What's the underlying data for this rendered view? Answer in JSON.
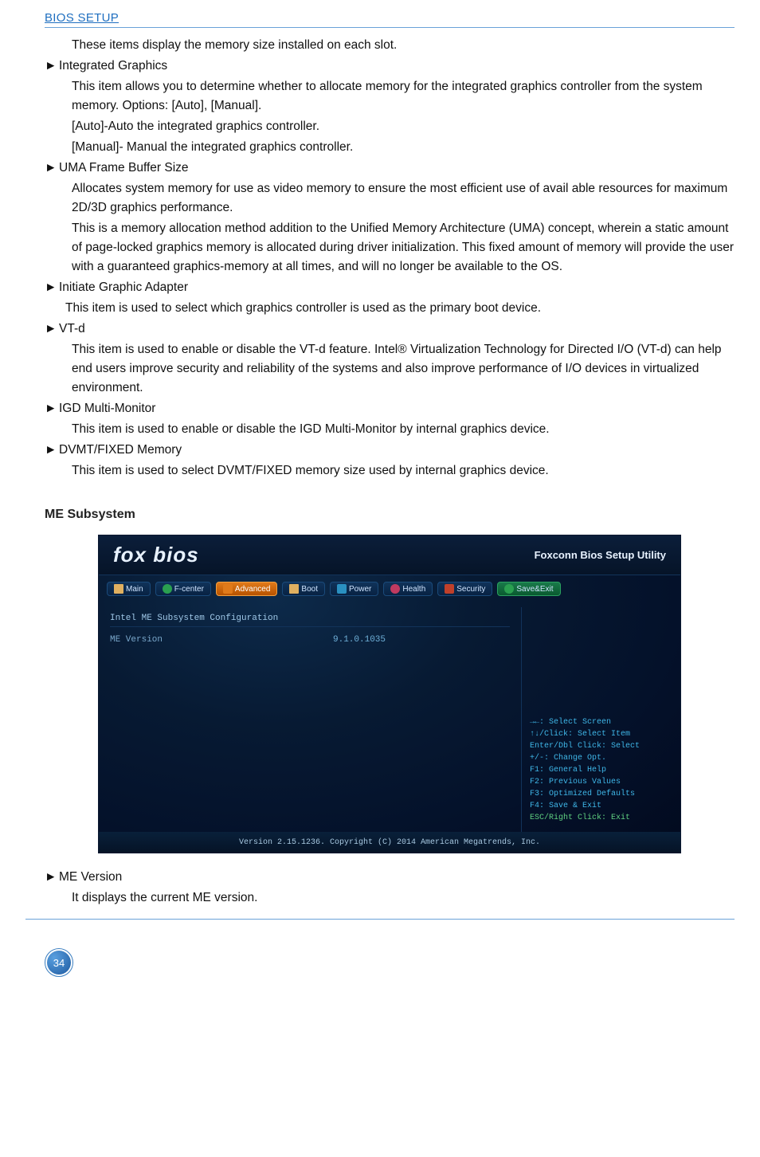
{
  "header": {
    "title": "BIOS SETUP"
  },
  "body": {
    "slots_note": "These items display the memory size installed on each slot.",
    "integrated_graphics": {
      "title": "Integrated Graphics",
      "p1": "This item allows you to determine whether to allocate memory for the integrated graphics controller from the system memory. Options: [Auto], [Manual].",
      "p2": "[Auto]-Auto the integrated graphics controller.",
      "p3": "[Manual]- Manual the integrated graphics controller."
    },
    "uma": {
      "title": "UMA Frame Buffer Size",
      "p1": "Allocates system memory for use as video memory to ensure the most efficient use of avail able resources for maximum 2D/3D graphics performance.",
      "p2": "This is a memory allocation method addition to the Unified Memory Architecture (UMA) concept, wherein a static amount of page-locked graphics memory is allocated during driver initialization. This fixed amount of memory will provide the user with a guaranteed graphics-memory at all times, and will no longer be available to the OS."
    },
    "initiate": {
      "title": "Initiate Graphic Adapter",
      "p1": "This item is used to select which graphics controller is used as the primary boot device."
    },
    "vtd": {
      "title": "VT-d",
      "p1": "This item is used to enable or disable the VT-d feature. Intel® Virtualization Technology for Directed I/O (VT-d) can help end users improve security and reliability of the systems and also improve performance of I/O devices in virtualized environment."
    },
    "igd": {
      "title": "IGD Multi-Monitor",
      "p1": "This item is used to enable or disable the IGD Multi-Monitor by internal graphics device."
    },
    "dvmt": {
      "title": "DVMT/FIXED Memory",
      "p1": "This item is used to select DVMT/FIXED memory size used by internal graphics device."
    },
    "me_version_item": {
      "title": "ME Version",
      "p1": "It displays the current ME version."
    }
  },
  "section_title": "ME Subsystem",
  "bios": {
    "logo": "fox bios",
    "utility_title": "Foxconn Bios Setup Utility",
    "tabs": {
      "main": "Main",
      "fcenter": "F-center",
      "advanced": "Advanced",
      "boot": "Boot",
      "power": "Power",
      "health": "Health",
      "security": "Security",
      "saveexit": "Save&Exit"
    },
    "panel_title": "Intel ME Subsystem Configuration",
    "row": {
      "label": "ME Version",
      "value": "9.1.0.1035"
    },
    "help": {
      "l1": "→←: Select Screen",
      "l2": "↑↓/Click: Select Item",
      "l3": "Enter/Dbl Click: Select",
      "l4": "+/-: Change Opt.",
      "l5": "F1: General Help",
      "l6": "F2: Previous Values",
      "l7": "F3: Optimized Defaults",
      "l8": "F4: Save & Exit",
      "l9": "ESC/Right Click: Exit"
    },
    "footer": "Version 2.15.1236. Copyright (C) 2014 American Megatrends, Inc."
  },
  "page_number": "34",
  "arrow": "►"
}
